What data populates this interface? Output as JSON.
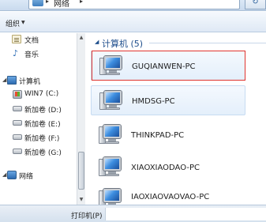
{
  "address_bar": {
    "path": "网络",
    "refresh_symbol": "↻"
  },
  "toolbar": {
    "organize_label": "组织"
  },
  "nav_pane": {
    "items": [
      {
        "label": "文档",
        "icon": "document-icon"
      },
      {
        "label": "音乐",
        "icon": "music-icon"
      },
      {
        "label": "计算机",
        "icon": "computer-icon"
      },
      {
        "label": "WIN7 (C:)",
        "icon": "windows-drive-icon"
      },
      {
        "label": "新加卷 (D:)",
        "icon": "drive-icon"
      },
      {
        "label": "新加卷 (E:)",
        "icon": "drive-icon"
      },
      {
        "label": "新加卷 (F:)",
        "icon": "drive-icon"
      },
      {
        "label": "新加卷 (G:)",
        "icon": "drive-icon"
      },
      {
        "label": "网络",
        "icon": "network-icon"
      }
    ]
  },
  "content": {
    "group_title": "计算机 (5)",
    "computers": [
      {
        "name": "GUQIANWEN-PC",
        "highlighted": true
      },
      {
        "name": "HMDSG-PC",
        "highlighted": true
      },
      {
        "name": "THINKPAD-PC",
        "highlighted": false
      },
      {
        "name": "XIAOXIAODAO-PC",
        "highlighted": false
      },
      {
        "name": "IAOXIAOVAOVAO-PC",
        "highlighted": false
      }
    ]
  },
  "status_bar": {
    "label": "打印机(P)"
  },
  "colors": {
    "selection_border": "#e0342f",
    "group_title": "#1e4e8c"
  }
}
